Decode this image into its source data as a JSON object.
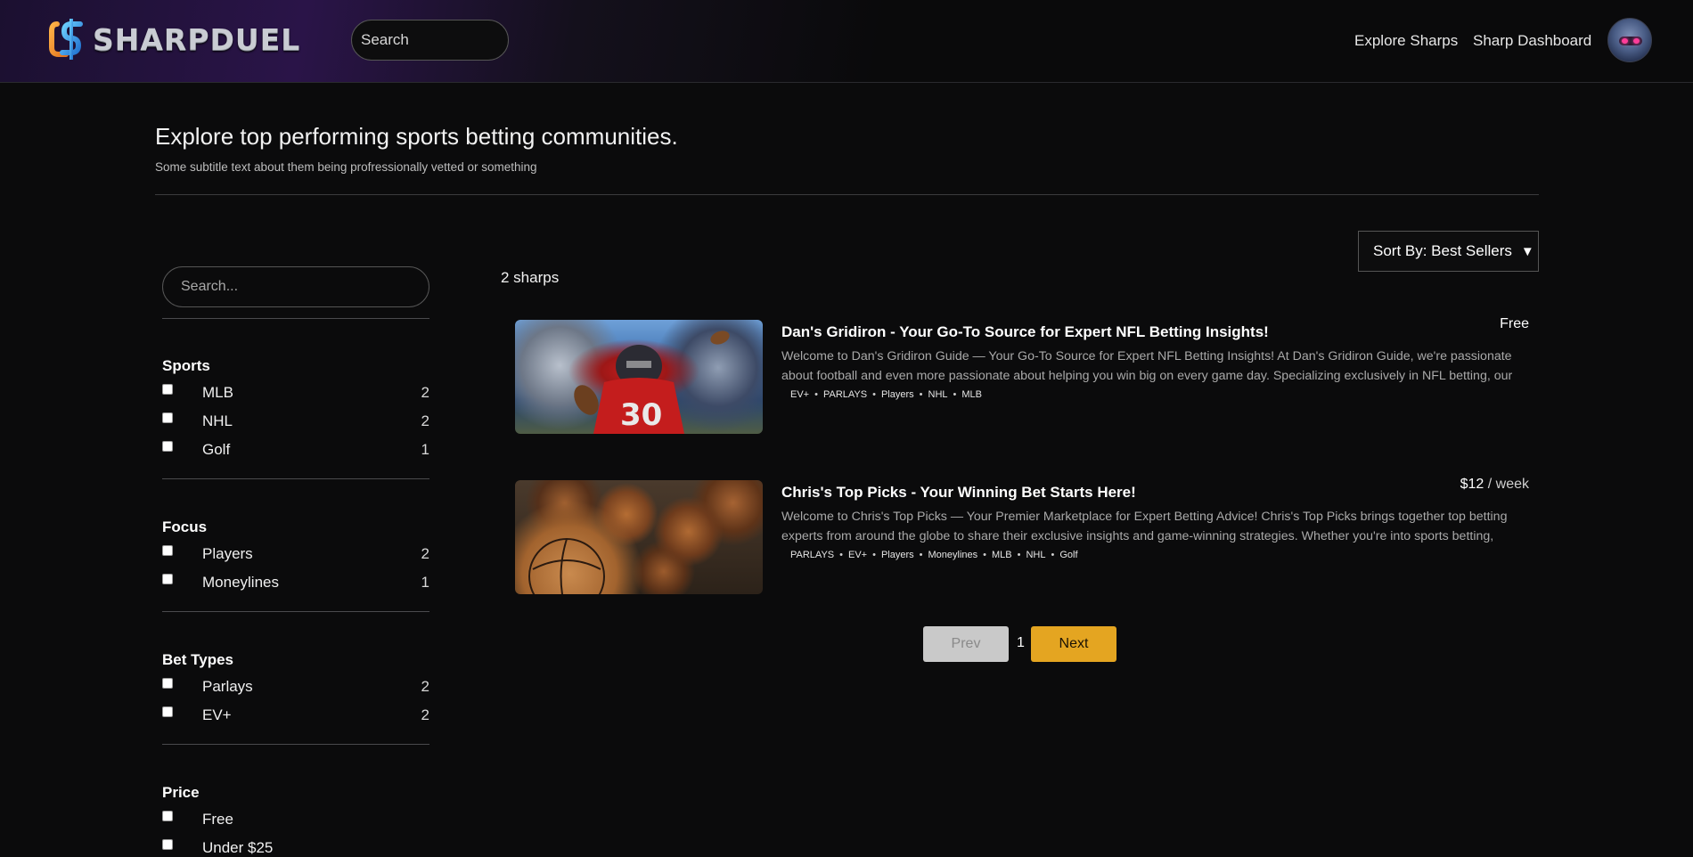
{
  "brand": {
    "name": "SHARPDUEL"
  },
  "header": {
    "search_placeholder": "Search",
    "nav": {
      "explore": "Explore Sharps",
      "dashboard": "Sharp Dashboard"
    }
  },
  "hero": {
    "title": "Explore top performing sports betting communities.",
    "subtitle": "Some subtitle text about them being profressionally vetted or something"
  },
  "sidebar": {
    "search_placeholder": "Search...",
    "groups": [
      {
        "title": "Sports",
        "items": [
          {
            "label": "MLB",
            "count": "2"
          },
          {
            "label": "NHL",
            "count": "2"
          },
          {
            "label": "Golf",
            "count": "1"
          }
        ]
      },
      {
        "title": "Focus",
        "items": [
          {
            "label": "Players",
            "count": "2"
          },
          {
            "label": "Moneylines",
            "count": "1"
          }
        ]
      },
      {
        "title": "Bet Types",
        "items": [
          {
            "label": "Parlays",
            "count": "2"
          },
          {
            "label": "EV+",
            "count": "2"
          }
        ]
      },
      {
        "title": "Price",
        "items": [
          {
            "label": "Free",
            "count": ""
          },
          {
            "label": "Under $25",
            "count": ""
          }
        ]
      }
    ]
  },
  "main": {
    "sort_label": "Sort By: Best Sellers",
    "sort_arrow": "▼",
    "count_text": "2 sharps",
    "cards": [
      {
        "title": "Dan's Gridiron - Your Go-To Source for Expert NFL Betting Insights!",
        "price": "Free",
        "price_unit": "",
        "description": "Welcome to Dan's Gridiron Guide — Your Go-To Source for Expert NFL Betting Insights! At Dan's Gridiron Guide, we're passionate about football and even more passionate about helping you win big on every game day. Specializing exclusively in NFL betting, our platform...",
        "tags": [
          "EV+",
          "PARLAYS",
          "Players",
          "NHL",
          "MLB"
        ],
        "image": "football-player-photo"
      },
      {
        "title": "Chris's Top Picks - Your Winning Bet Starts Here!",
        "price": "$12",
        "price_unit": " / week",
        "description": "Welcome to Chris's Top Picks — Your Premier Marketplace for Expert Betting Advice! Chris's Top Picks brings together top betting experts from around the globe to share their exclusive insights and game-winning strategies. Whether you're into sports betting, horse...",
        "tags": [
          "PARLAYS",
          "EV+",
          "Players",
          "Moneylines",
          "MLB",
          "NHL",
          "Golf"
        ],
        "image": "basketballs-photo"
      }
    ],
    "pagination": {
      "prev": "Prev",
      "current": "1",
      "next": "Next"
    }
  },
  "colors": {
    "background": "#0b0b0c",
    "accent": "#e4a521",
    "disabled": "#c9c9c9"
  }
}
